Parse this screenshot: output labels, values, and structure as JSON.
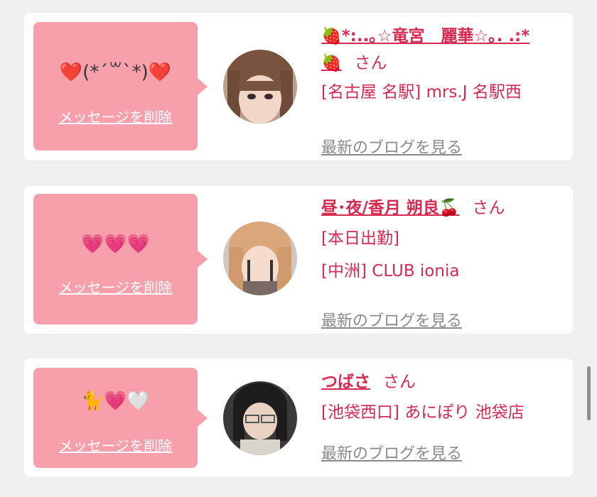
{
  "cards": [
    {
      "emoji": "❤️(*´꒳`*)❤️",
      "delete_label": "メッセージを削除",
      "name_line1": "🍓*:..｡☆竜宮　麗華☆｡. .:*",
      "name_line2": "🍓",
      "suffix": "さん",
      "shop_lines": [
        "[名古屋 名駅] mrs.J 名駅西"
      ],
      "blog_label": "最新のブログを見る",
      "avatar_icon": "avatar-photo"
    },
    {
      "emoji": "💗💗💗",
      "delete_label": "メッセージを削除",
      "name_line1": "昼･夜/香月 朔良🍒",
      "suffix": "さん",
      "shop_lines": [
        "[本日出勤]",
        "[中洲] CLUB ionia"
      ],
      "blog_label": "最新のブログを見る",
      "avatar_icon": "avatar-photo"
    },
    {
      "emoji": "🐈💗🤍",
      "delete_label": "メッセージを削除",
      "name_line1": "つばさ",
      "suffix": "さん",
      "shop_lines": [
        "[池袋西口] あにぽり 池袋店"
      ],
      "blog_label": "最新のブログを見る",
      "avatar_icon": "avatar-photo"
    }
  ],
  "colors": {
    "accent": "#d62a50",
    "bubble": "#f7a0ac",
    "link_gray": "#8a8a8a",
    "page_bg": "#f0f0f0"
  }
}
